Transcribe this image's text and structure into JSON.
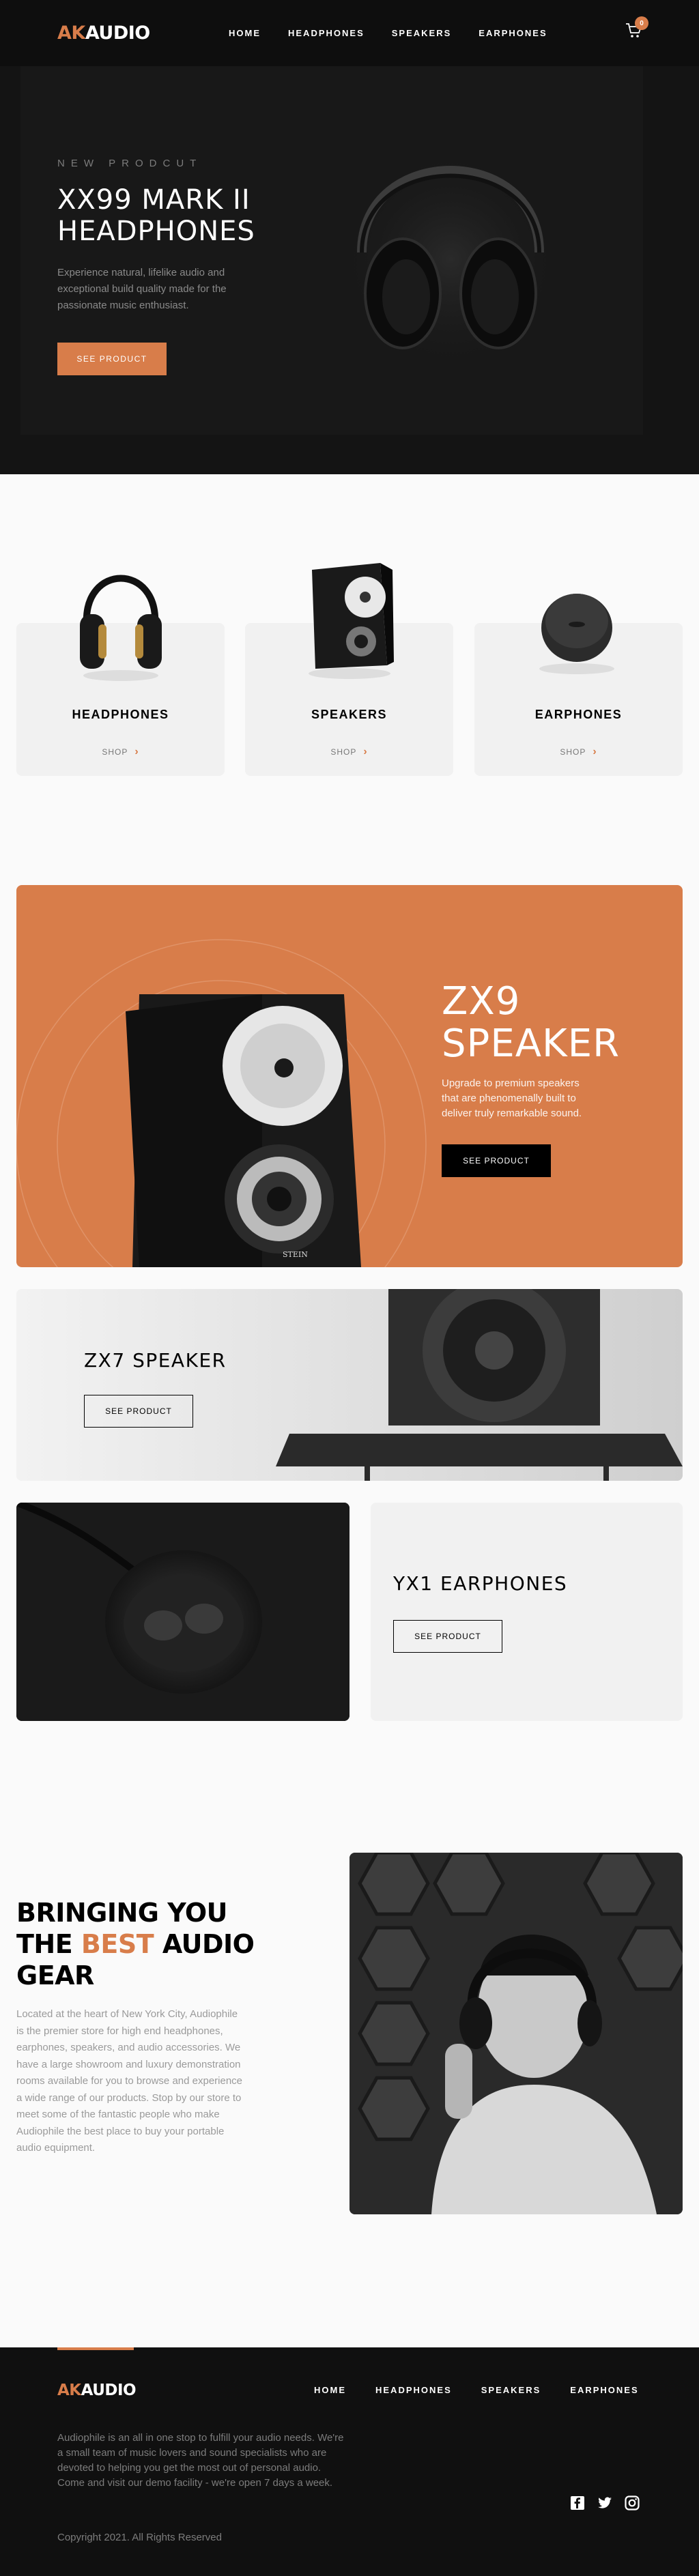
{
  "header": {
    "logo_accent": "AK",
    "logo_rest": "AUDIO",
    "nav": [
      "HOME",
      "HEADPHONES",
      "SPEAKERS",
      "EARPHONES"
    ],
    "cart_count": "0"
  },
  "hero": {
    "eyebrow": "NEW PRODCUT",
    "title_line1": "XX99 MARK II",
    "title_line2": "HEADPHONES",
    "description": "Experience natural, lifelike audio and exceptional build quality made for the passionate music enthusiast.",
    "button": "SEE PRODUCT"
  },
  "categories": [
    {
      "name": "HEADPHONES",
      "shop": "SHOP"
    },
    {
      "name": "SPEAKERS",
      "shop": "SHOP"
    },
    {
      "name": "EARPHONES",
      "shop": "SHOP"
    }
  ],
  "zx9": {
    "title_line1": "ZX9",
    "title_line2": "SPEAKER",
    "description": "Upgrade to premium speakers that are phenomenally built to deliver truly remarkable sound.",
    "button": "SEE PRODUCT"
  },
  "zx7": {
    "title": "ZX7 SPEAKER",
    "button": "SEE PRODUCT"
  },
  "yx1": {
    "title": "YX1 EARPHONES",
    "button": "SEE PRODUCT"
  },
  "about": {
    "title_pre": "BRINGING YOU THE ",
    "title_accent": "BEST",
    "title_post": " AUDIO GEAR",
    "description": "Located at the heart of New York City, Audiophile is the premier store for high end headphones, earphones, speakers, and audio accessories. We have a large showroom and luxury demonstration rooms available for you to browse and experience a wide range of our products. Stop by our store to meet some of the fantastic people who make Audiophile the best place to buy your portable audio equipment."
  },
  "footer": {
    "logo_accent": "AK",
    "logo_rest": "AUDIO",
    "nav": [
      "HOME",
      "HEADPHONES",
      "SPEAKERS",
      "EARPHONES"
    ],
    "description": "Audiophile is an all in one stop to fulfill your audio needs. We're a small team of music lovers and sound specialists who are devoted to helping you get the most out of personal audio. Come and visit our demo facility - we're open 7 days a week.",
    "copyright": "Copyright 2021. All Rights Reserved",
    "socials": [
      "facebook-icon",
      "twitter-icon",
      "instagram-icon"
    ]
  },
  "colors": {
    "accent": "#d87d4a",
    "dark": "#101010",
    "light_card": "#f1f1f1"
  }
}
